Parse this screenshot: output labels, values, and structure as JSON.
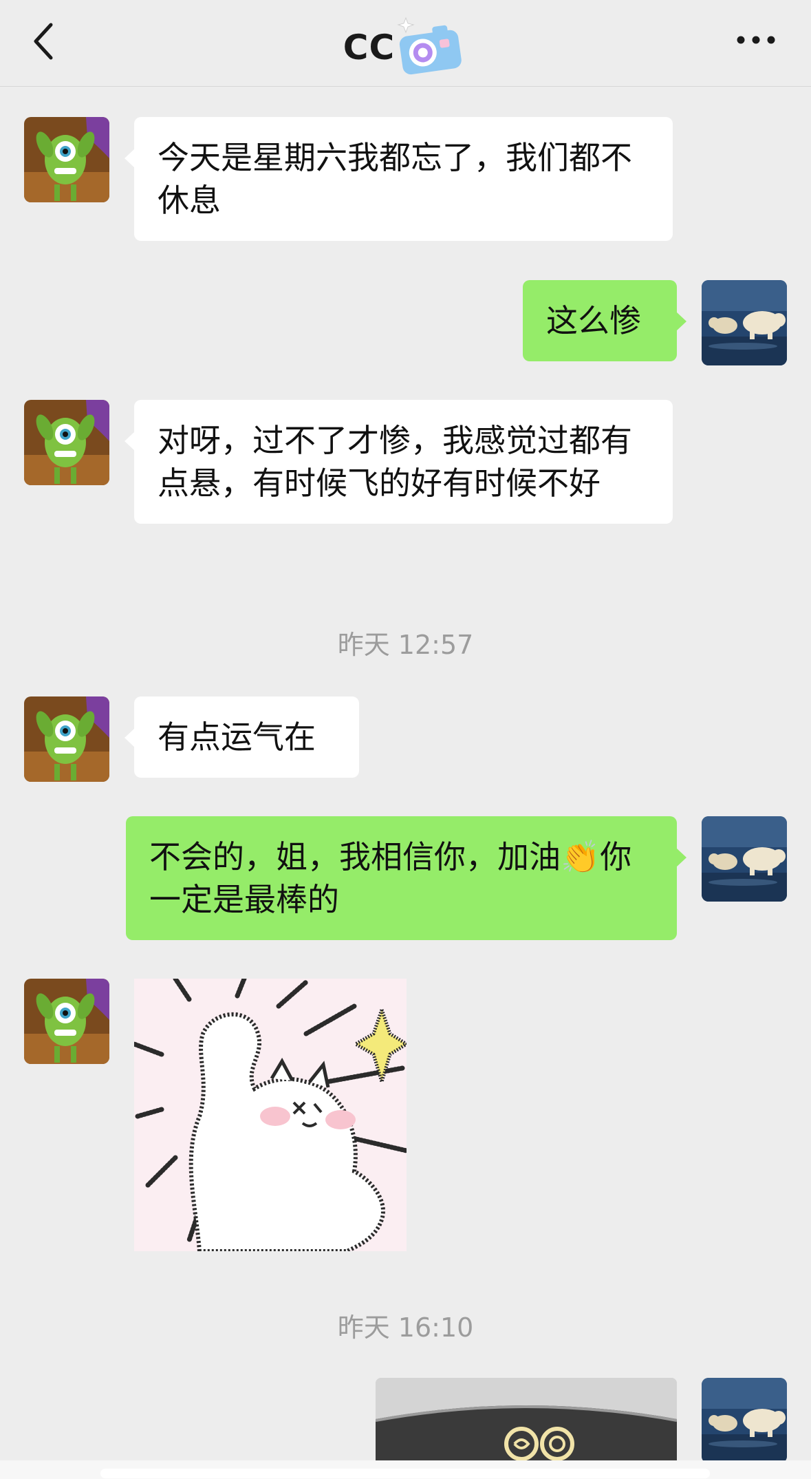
{
  "header": {
    "title": "CC",
    "back_icon": "chevron-left-icon",
    "camera_sticker": "camera-emoji-icon",
    "more_icon": "more-dots-icon"
  },
  "messages": [
    {
      "side": "in",
      "text": "今天是星期六我都忘了，我们都不休息"
    },
    {
      "side": "out",
      "text": "这么惨"
    },
    {
      "side": "in",
      "text": "对呀，过不了才惨，我感觉过都有点悬，有时候飞的好有时候不好"
    },
    {
      "side": "in",
      "text": "有点运气在"
    },
    {
      "side": "out",
      "text": "不会的，姐，我相信你，加油👏你一定是最棒的",
      "emoji": "👏"
    },
    {
      "side": "in",
      "type": "sticker",
      "sticker": "white-cat-sparkle-sticker"
    },
    {
      "side": "out",
      "type": "image",
      "image": "photo-thumbnail"
    }
  ],
  "timestamps": [
    {
      "text": "昨天 12:57"
    },
    {
      "text": "昨天 16:10"
    }
  ],
  "colors": {
    "background": "#ededed",
    "incoming_bubble": "#ffffff",
    "outgoing_bubble": "#95ec69",
    "timestamp": "#9c9c9c"
  },
  "avatars": {
    "contact": "green-monster-avatar",
    "me": "polar-bear-avatar"
  }
}
